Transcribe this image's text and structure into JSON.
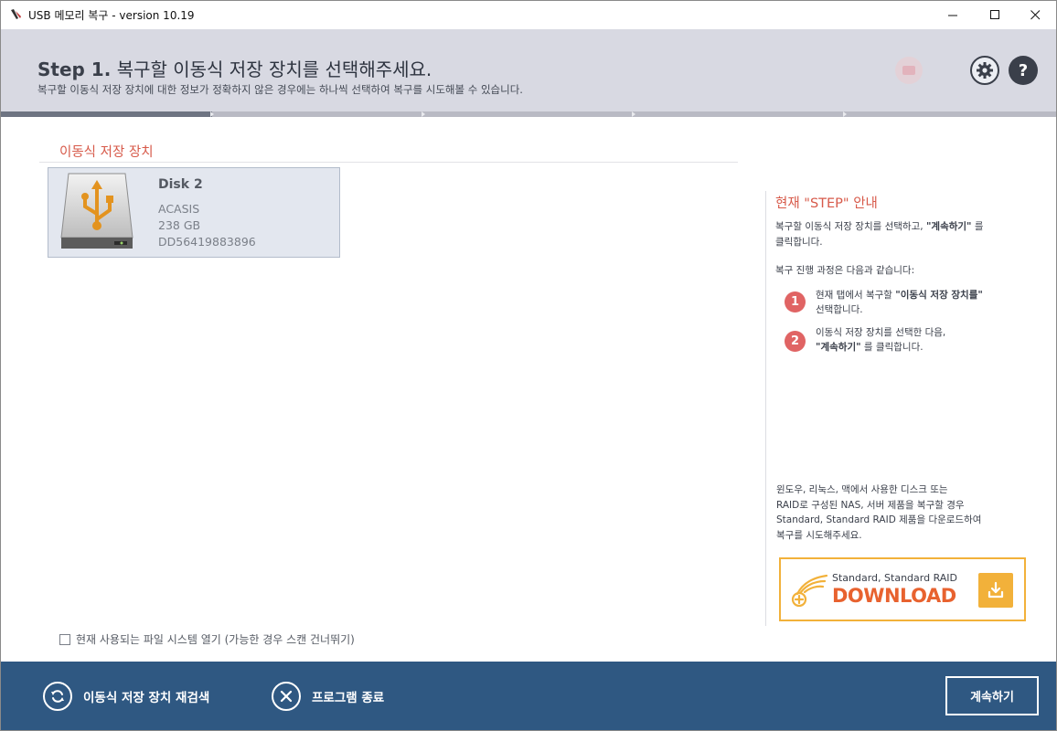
{
  "window": {
    "title": "USB 메모리 복구 - version 10.19"
  },
  "header": {
    "step_label": "Step 1.",
    "step_title": "복구할 이동식 저장 장치를 선택해주세요.",
    "subtitle": "복구할 이동식 저장 장치에 대한 정보가 정확하지 않은 경우에는 하나씩 선택하여 복구를 시도해볼 수 있습니다.",
    "settings_icon": "gear-icon",
    "help_label": "?",
    "progress_fraction": 0.2,
    "progress_steps": 5
  },
  "devices": {
    "section_title": "이동식 저장 장치",
    "items": [
      {
        "name": "Disk 2",
        "vendor": "ACASIS",
        "size": "238 GB",
        "serial": "DD56419883896",
        "icon": "usb-drive-icon"
      }
    ]
  },
  "options": {
    "open_fs_label": "현재 사용되는 파일 시스템 열기 (가능한 경우 스캔 건너뛰기)",
    "open_fs_checked": false
  },
  "guide": {
    "title": "현재 \"STEP\" 안내",
    "intro_line1_pre": "복구할 이동식 저장 장치를 선택하고, ",
    "intro_line1_bold": "\"계속하기\"",
    "intro_line1_post": " 를",
    "intro_line2": "클릭합니다.",
    "process_text": "복구 진행 과정은 다음과 같습니다:",
    "steps": [
      {
        "num": "1",
        "line1_pre": "현재 탭에서 복구할 ",
        "line1_bold": "\"이동식 저장 장치를\"",
        "line2": "선택합니다."
      },
      {
        "num": "2",
        "line1": "이동식 저장 장치를 선택한 다음,",
        "line2_bold": "\"계속하기\"",
        "line2_post": " 를 클릭합니다."
      }
    ],
    "promo_lines": [
      "윈도우, 리눅스, 맥에서 사용한 디스크 또는",
      "RAID로 구성된 NAS, 서버 제품을 복구할 경우",
      "Standard, Standard RAID 제품을 다운로드하여",
      "복구를 시도해주세요."
    ],
    "download": {
      "subtitle": "Standard, Standard RAID",
      "label": "DOWNLOAD",
      "accent": "#f2b13a",
      "text_color": "#e8622f"
    }
  },
  "footer": {
    "rescan_label": "이동식 저장 장치 재검색",
    "exit_label": "프로그램 종료",
    "continue_label": "계속하기",
    "background": "#2f5882"
  }
}
